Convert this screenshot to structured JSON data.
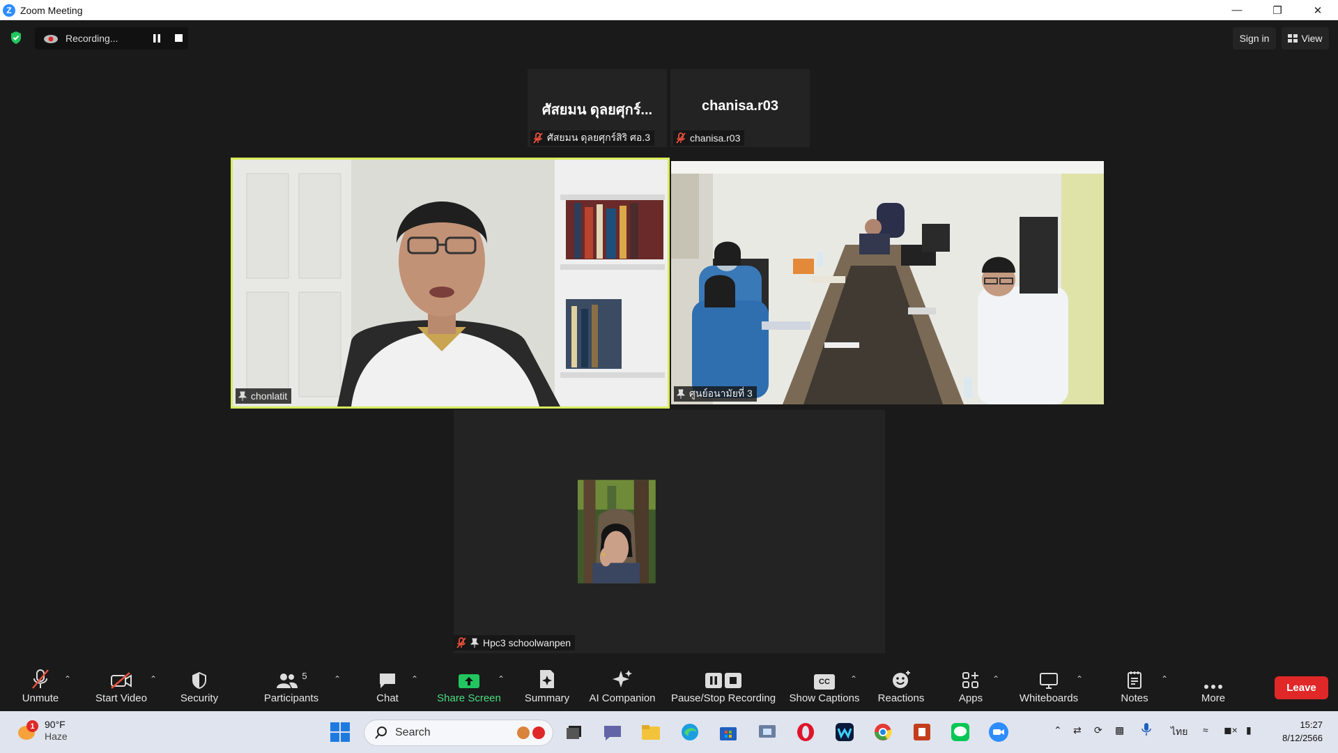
{
  "window": {
    "title": "Zoom Meeting"
  },
  "recording": {
    "status": "Recording..."
  },
  "topbar": {
    "sign_in": "Sign in",
    "view": "View"
  },
  "thumbnails": [
    {
      "big_name": "ศัสยมน ดุลยศุกร์...",
      "label": "ศัสยมน ดุลยศุกร์สิริ ศอ.3"
    },
    {
      "big_name": "chanisa.r03",
      "label": "chanisa.r03"
    }
  ],
  "videos": [
    {
      "label": "chonlatit"
    },
    {
      "label": "ศูนย์อนามัยที่ 3"
    },
    {
      "label": "Hpc3 schoolwanpen"
    }
  ],
  "toolbar": {
    "unmute": "Unmute",
    "start_video": "Start Video",
    "security": "Security",
    "participants": "Participants",
    "participants_count": "5",
    "chat": "Chat",
    "share_screen": "Share Screen",
    "summary": "Summary",
    "ai_companion": "AI Companion",
    "pause_stop_recording": "Pause/Stop Recording",
    "show_captions": "Show Captions",
    "captions_badge": "CC",
    "reactions": "Reactions",
    "apps": "Apps",
    "whiteboards": "Whiteboards",
    "notes": "Notes",
    "more": "More",
    "leave": "Leave"
  },
  "taskbar": {
    "weather_temp": "90°F",
    "weather_desc": "Haze",
    "weather_badge": "1",
    "search_placeholder": "Search",
    "language": "ไทย",
    "time": "15:27",
    "date": "8/12/2566"
  },
  "colors": {
    "active_speaker": "#d7ec5c",
    "leave": "#e02828",
    "share": "#22c55e",
    "zoom_blue": "#2D8CFF"
  }
}
